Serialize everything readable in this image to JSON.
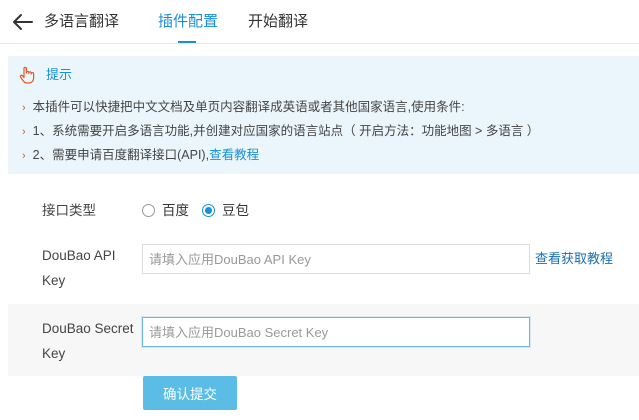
{
  "header": {
    "title": "多语言翻译",
    "tabs": [
      {
        "label": "插件配置",
        "active": true
      },
      {
        "label": "开始翻译",
        "active": false
      }
    ]
  },
  "tips": {
    "title": "提示",
    "line1": "本插件可以快捷把中文文档及单页内容翻译成英语或者其他国家语言,使用条件:",
    "line2": "1、系统需要开启多语言功能,并创建对应国家的语言站点（ 开启方法：功能地图 > 多语言 ）",
    "line3_text": "2、需要申请百度翻译接口(API),",
    "line3_link": "查看教程"
  },
  "form": {
    "api_type": {
      "label": "接口类型",
      "options": [
        {
          "label": "百度",
          "checked": false
        },
        {
          "label": "豆包",
          "checked": true
        }
      ]
    },
    "api_key": {
      "label_line1": "DouBao API",
      "label_line2": "Key",
      "value": "",
      "placeholder": "请填入应用DouBao API Key",
      "help_link": "查看获取教程"
    },
    "secret_key": {
      "label_line1": "DouBao Secret",
      "label_line2": "Key",
      "value": "",
      "placeholder": "请填入应用DouBao Secret Key"
    },
    "submit_label": "确认提交"
  },
  "colors": {
    "accent": "#1a8fd6",
    "tips_background": "#eaf6fb",
    "bullet": "#e8552a",
    "submit_background": "#5bbde6"
  },
  "icons": [
    "back-arrow-icon",
    "pointing-hand-icon"
  ]
}
